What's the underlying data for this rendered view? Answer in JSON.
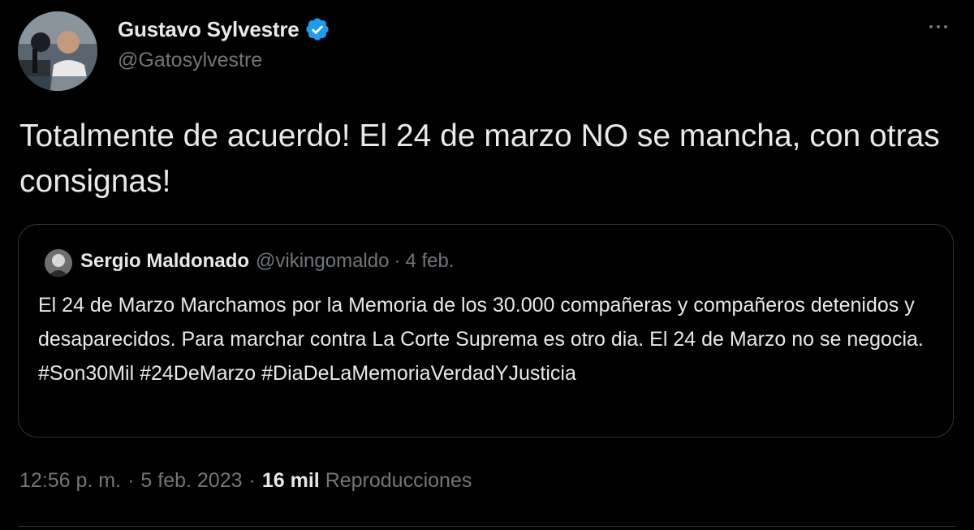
{
  "author": {
    "name": "Gustavo Sylvestre",
    "handle": "@Gatosylvestre",
    "verified": true,
    "avatar_icon": "profile-photo-avatar",
    "verified_icon": "verified-badge-icon",
    "verified_color": "#1d9bf0"
  },
  "tweet": {
    "text": "Totalmente de acuerdo! El 24 de marzo NO se mancha, con otras consignas!"
  },
  "quoted_tweet": {
    "author_name": "Sergio Maldonado",
    "author_handle": "@vikingomaldo",
    "separator": "·",
    "date": "4 feb.",
    "text": "El 24 de Marzo Marchamos por la Memoria de los 30.000 compañeras y compañeros detenidos y desaparecidos. Para marchar contra La Corte Suprema es otro dia. El 24 de Marzo no se negocia. #Son30Mil #24DeMarzo #DiaDeLaMemoriaVerdadYJusticia"
  },
  "footer": {
    "time": "12:56 p. m.",
    "separator": "·",
    "date": "5 feb. 2023",
    "views_count": "16 mil",
    "views_label": "Reproducciones"
  },
  "colors": {
    "background": "#000000",
    "text_primary": "#e7e9ea",
    "text_secondary": "#71767b",
    "border": "#2f3336"
  }
}
